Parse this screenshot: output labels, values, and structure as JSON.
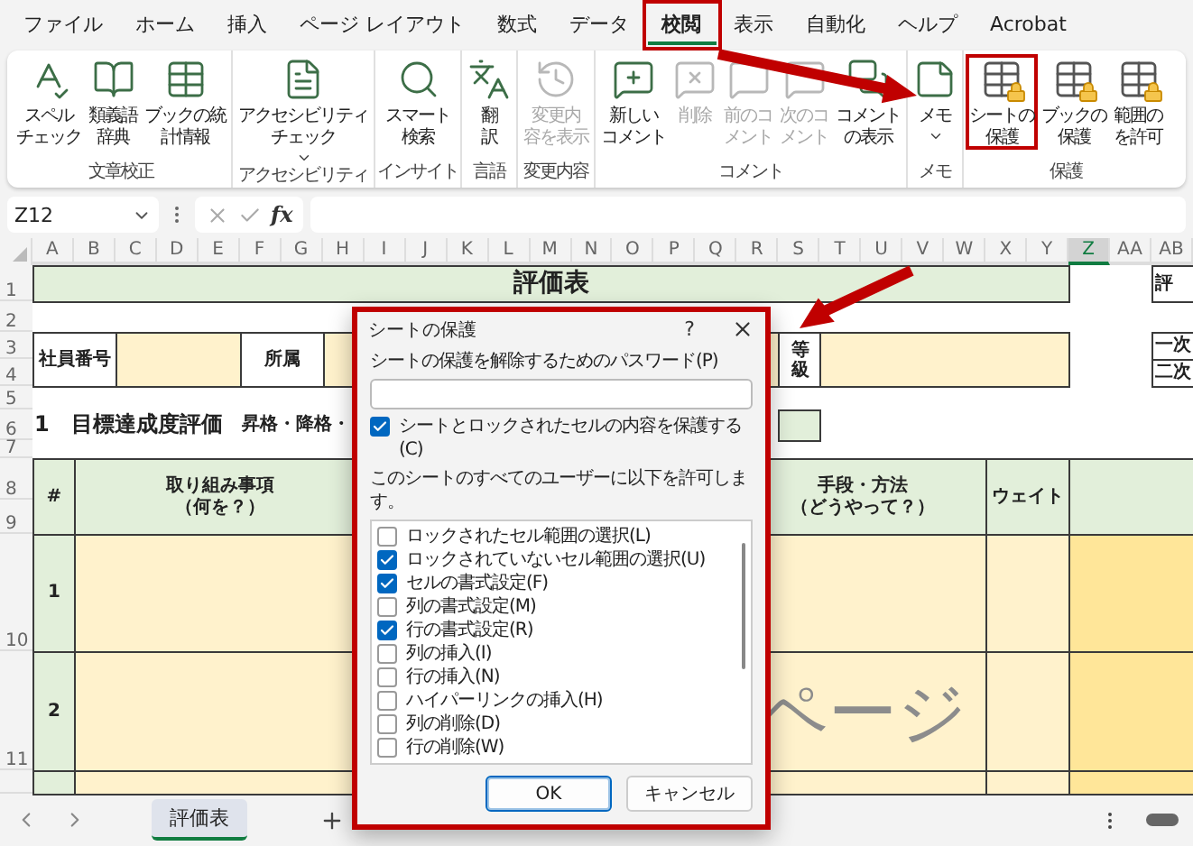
{
  "menu_tabs": [
    {
      "label": "ファイル",
      "selected": false,
      "highlighted": false
    },
    {
      "label": "ホーム",
      "selected": false,
      "highlighted": false
    },
    {
      "label": "挿入",
      "selected": false,
      "highlighted": false
    },
    {
      "label": "ページ レイアウト",
      "selected": false,
      "highlighted": false
    },
    {
      "label": "数式",
      "selected": false,
      "highlighted": false
    },
    {
      "label": "データ",
      "selected": false,
      "highlighted": false
    },
    {
      "label": "校閲",
      "selected": true,
      "highlighted": true
    },
    {
      "label": "表示",
      "selected": false,
      "highlighted": false
    },
    {
      "label": "自動化",
      "selected": false,
      "highlighted": false
    },
    {
      "label": "ヘルプ",
      "selected": false,
      "highlighted": false
    },
    {
      "label": "Acrobat",
      "selected": false,
      "highlighted": false
    }
  ],
  "ribbon": [
    {
      "label": "文章校正",
      "buttons": [
        {
          "lines": [
            "スペル",
            "チェック"
          ],
          "disabled": false,
          "dropdown": false,
          "highlighted": false
        },
        {
          "lines": [
            "類義語",
            "辞典"
          ],
          "disabled": false,
          "dropdown": false,
          "highlighted": false
        },
        {
          "lines": [
            "ブックの統",
            "計情報"
          ],
          "disabled": false,
          "dropdown": false,
          "highlighted": false
        }
      ]
    },
    {
      "label": "アクセシビリティ",
      "buttons": [
        {
          "lines": [
            "アクセシビリティ",
            "チェック"
          ],
          "disabled": false,
          "dropdown": true,
          "highlighted": false
        }
      ]
    },
    {
      "label": "インサイト",
      "buttons": [
        {
          "lines": [
            "スマート",
            "検索"
          ],
          "disabled": false,
          "dropdown": false,
          "highlighted": false
        }
      ]
    },
    {
      "label": "言語",
      "buttons": [
        {
          "lines": [
            "翻",
            "訳"
          ],
          "disabled": false,
          "dropdown": false,
          "highlighted": false
        }
      ]
    },
    {
      "label": "変更内容",
      "buttons": [
        {
          "lines": [
            "変更内",
            "容を表示"
          ],
          "disabled": true,
          "dropdown": false,
          "highlighted": false
        }
      ]
    },
    {
      "label": "コメント",
      "buttons": [
        {
          "lines": [
            "新しい",
            "コメント"
          ],
          "disabled": false,
          "dropdown": false,
          "highlighted": false
        },
        {
          "lines": [
            "削除"
          ],
          "disabled": true,
          "dropdown": false,
          "highlighted": false
        },
        {
          "lines": [
            "前のコ",
            "メント"
          ],
          "disabled": true,
          "dropdown": false,
          "highlighted": false
        },
        {
          "lines": [
            "次のコ",
            "メント"
          ],
          "disabled": true,
          "dropdown": false,
          "highlighted": false
        },
        {
          "lines": [
            "コメント",
            "の表示"
          ],
          "disabled": false,
          "dropdown": false,
          "highlighted": false
        }
      ]
    },
    {
      "label": "メモ",
      "buttons": [
        {
          "lines": [
            "メモ"
          ],
          "disabled": false,
          "dropdown": true,
          "highlighted": false
        }
      ]
    },
    {
      "label": "保護",
      "buttons": [
        {
          "lines": [
            "シートの",
            "保護"
          ],
          "disabled": false,
          "dropdown": false,
          "highlighted": true
        },
        {
          "lines": [
            "ブックの",
            "保護"
          ],
          "disabled": false,
          "dropdown": false,
          "highlighted": false
        },
        {
          "lines": [
            "範囲の",
            "を許可"
          ],
          "disabled": false,
          "dropdown": false,
          "highlighted": false
        }
      ]
    }
  ],
  "formula_bar": {
    "name_box": "Z12",
    "function_label": "fx"
  },
  "sheet": {
    "columns": [
      {
        "label": "A",
        "selected": false
      },
      {
        "label": "B",
        "selected": false
      },
      {
        "label": "C",
        "selected": false
      },
      {
        "label": "D",
        "selected": false
      },
      {
        "label": "E",
        "selected": false
      },
      {
        "label": "F",
        "selected": false
      },
      {
        "label": "G",
        "selected": false
      },
      {
        "label": "H",
        "selected": false
      },
      {
        "label": "I",
        "selected": false
      },
      {
        "label": "J",
        "selected": false
      },
      {
        "label": "K",
        "selected": false
      },
      {
        "label": "L",
        "selected": false
      },
      {
        "label": "M",
        "selected": false
      },
      {
        "label": "N",
        "selected": false
      },
      {
        "label": "O",
        "selected": false
      },
      {
        "label": "P",
        "selected": false
      },
      {
        "label": "Q",
        "selected": false
      },
      {
        "label": "R",
        "selected": false
      },
      {
        "label": "S",
        "selected": false
      },
      {
        "label": "T",
        "selected": false
      },
      {
        "label": "U",
        "selected": false
      },
      {
        "label": "V",
        "selected": false
      },
      {
        "label": "W",
        "selected": false
      },
      {
        "label": "X",
        "selected": false
      },
      {
        "label": "Y",
        "selected": false
      },
      {
        "label": "Z",
        "selected": true
      },
      {
        "label": "AA",
        "selected": false
      },
      {
        "label": "AB",
        "selected": false
      }
    ],
    "row_numbers": [
      "1",
      "2",
      "3",
      "4",
      "5",
      "6",
      "7",
      "8",
      "9",
      "10",
      "11"
    ],
    "title": "評価表",
    "corner_label": "評",
    "employee_no_label": "社員番号",
    "department_label": "所属",
    "grade_label": "等級",
    "approver_labels": [
      "一次",
      "二次"
    ],
    "section_title": "1　目標達成度評価",
    "section_note": "昇格・降格・",
    "headers": [
      {
        "lines": [
          "#"
        ]
      },
      {
        "lines": [
          "取り組み事項",
          "（何を？）"
        ]
      },
      {
        "lines": [
          "手段・方法",
          "（どうやって？）"
        ]
      },
      {
        "lines": [
          "ウェイト"
        ]
      }
    ],
    "task_numbers": [
      "1",
      "2"
    ],
    "page_watermark": "ページ"
  },
  "sheet_tabs": [
    {
      "label": "評価表",
      "selected": true
    }
  ],
  "dialog": {
    "title": "シートの保護",
    "help": "?",
    "highlighted": true,
    "password_label": "シートの保護を解除するためのパスワード(P)",
    "protect": {
      "label": "シートとロックされたセルの内容を保護する(C)",
      "checked": true
    },
    "allow_label": "このシートのすべてのユーザーに以下を許可します。",
    "permissions": [
      {
        "label": "ロックされたセル範囲の選択(L)",
        "checked": false
      },
      {
        "label": "ロックされていないセル範囲の選択(U)",
        "checked": true
      },
      {
        "label": "セルの書式設定(F)",
        "checked": true
      },
      {
        "label": "列の書式設定(M)",
        "checked": false
      },
      {
        "label": "行の書式設定(R)",
        "checked": true
      },
      {
        "label": "列の挿入(I)",
        "checked": false
      },
      {
        "label": "行の挿入(N)",
        "checked": false
      },
      {
        "label": "ハイパーリンクの挿入(H)",
        "checked": false
      },
      {
        "label": "列の削除(D)",
        "checked": false
      },
      {
        "label": "行の削除(W)",
        "checked": false
      }
    ],
    "buttons": [
      {
        "label": "OK",
        "default": true
      },
      {
        "label": "キャンセル",
        "default": false
      }
    ]
  }
}
